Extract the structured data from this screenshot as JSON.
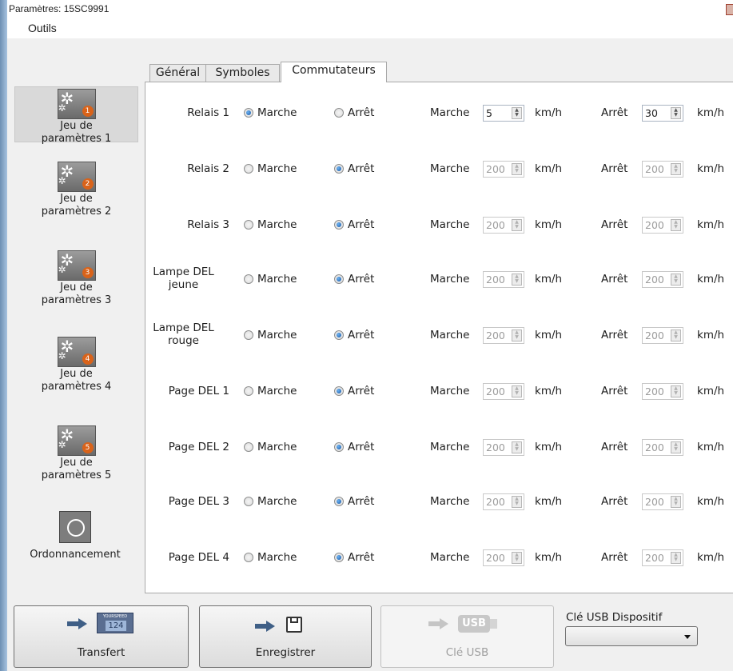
{
  "window": {
    "title": "Paramètres: 15SC9991"
  },
  "menu": {
    "tools": "Outils"
  },
  "sidebar": {
    "items": [
      {
        "label": "Jeu de paramètres 1",
        "line1": "Jeu de",
        "line2": "paramètres 1",
        "badge": "1",
        "icon": "gears-icon",
        "active": true
      },
      {
        "label": "Jeu de paramètres 2",
        "line1": "Jeu de",
        "line2": "paramètres 2",
        "badge": "2",
        "icon": "gears-icon"
      },
      {
        "label": "Jeu de paramètres 3",
        "line1": "Jeu de",
        "line2": "paramètres 3",
        "badge": "3",
        "icon": "gears-icon"
      },
      {
        "label": "Jeu de paramètres 4",
        "line1": "Jeu de",
        "line2": "paramètres 4",
        "badge": "4",
        "icon": "gears-icon"
      },
      {
        "label": "Jeu de paramètres 5",
        "line1": "Jeu de",
        "line2": "paramètres 5",
        "badge": "5",
        "icon": "gears-icon"
      },
      {
        "label": "Ordonnancement",
        "icon": "clock-icon"
      }
    ]
  },
  "tabs": [
    {
      "label": "Général"
    },
    {
      "label": "Symboles"
    },
    {
      "label": "Commutateurs",
      "active": true
    }
  ],
  "switches": {
    "on_label": "Marche",
    "off_label": "Arrêt",
    "unit": "km/h",
    "rows": [
      {
        "label": "Relais 1",
        "state": "on",
        "on_speed": "5",
        "off_speed": "30",
        "enabled": true
      },
      {
        "label": "Relais 2",
        "state": "off",
        "on_speed": "200",
        "off_speed": "200",
        "enabled": false
      },
      {
        "label": "Relais 3",
        "state": "off",
        "on_speed": "200",
        "off_speed": "200",
        "enabled": false
      },
      {
        "label_line1": "Lampe DEL",
        "label_line2": "jeune",
        "state": "off",
        "on_speed": "200",
        "off_speed": "200",
        "enabled": false
      },
      {
        "label_line1": "Lampe DEL",
        "label_line2": "rouge",
        "state": "off",
        "on_speed": "200",
        "off_speed": "200",
        "enabled": false
      },
      {
        "label": "Page DEL 1",
        "state": "off",
        "on_speed": "200",
        "off_speed": "200",
        "enabled": false
      },
      {
        "label": "Page DEL 2",
        "state": "off",
        "on_speed": "200",
        "off_speed": "200",
        "enabled": false
      },
      {
        "label": "Page DEL 3",
        "state": "off",
        "on_speed": "200",
        "off_speed": "200",
        "enabled": false
      },
      {
        "label": "Page DEL 4",
        "state": "off",
        "on_speed": "200",
        "off_speed": "200",
        "enabled": false
      }
    ]
  },
  "buttons": {
    "transfer": {
      "label": "Transfert",
      "display_brand": "YOURSPEED",
      "display_value": "124"
    },
    "save": {
      "label": "Enregistrer"
    },
    "usb": {
      "label": "Clé USB",
      "icon_text": "USB",
      "enabled": false
    }
  },
  "usb_device": {
    "label": "Clé USB Dispositif",
    "selected": ""
  }
}
